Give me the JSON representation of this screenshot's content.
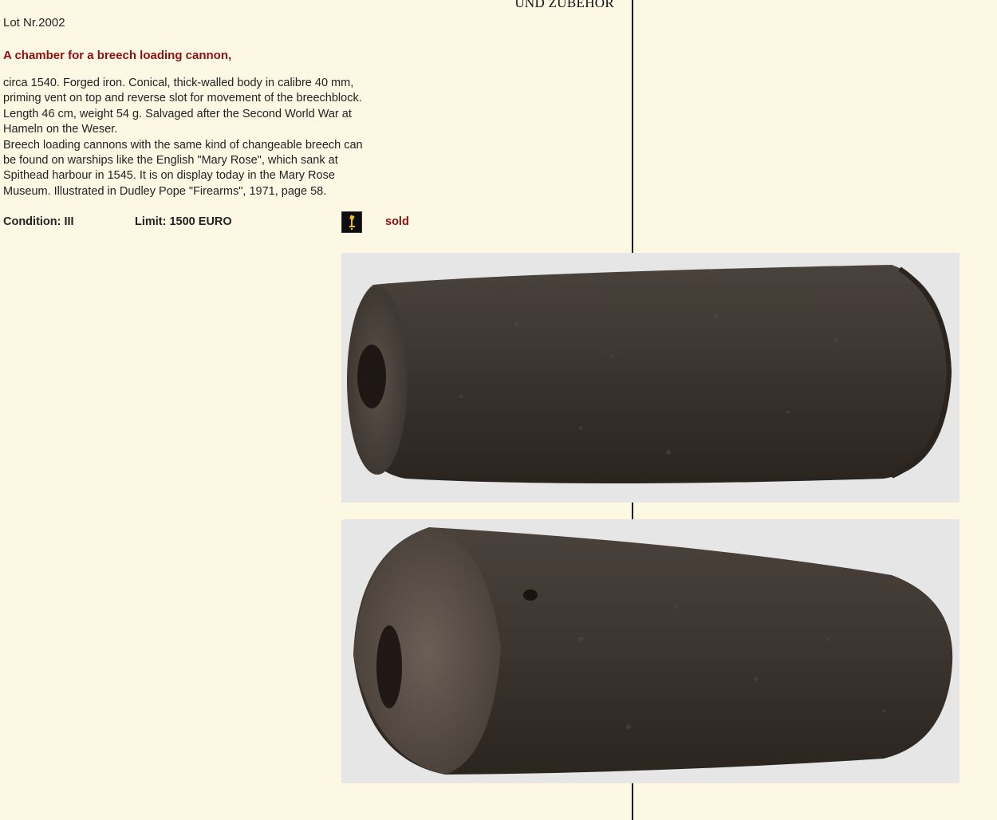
{
  "header": {
    "fragment": "UND ZUBEHÖR"
  },
  "lot": {
    "number": "Lot Nr.2002",
    "title": "A chamber for a breech loading cannon,",
    "description_lines": [
      "circa 1540. Forged iron. Conical, thick-walled body in calibre 40 mm,",
      "priming vent on top and reverse slot for movement of the breechblock.",
      "Length 46 cm, weight 54 g. Salvaged after the Second World War at",
      "Hameln on the Weser.",
      "Breech loading cannons with the same kind of changeable breech can",
      "be found on warships like the English \"Mary Rose\", which sank at",
      "Spithead harbour in 1545. It is on display today in the Mary Rose",
      "Museum. Illustrated in Dudley Pope \"Firearms\", 1971, page 58."
    ],
    "condition": "Condition: III",
    "limit": "Limit: 1500 EURO",
    "status_icon": "auction-hammer-icon",
    "status": "sold"
  },
  "photos": [
    {
      "name": "cannon-chamber-photo-side"
    },
    {
      "name": "cannon-chamber-photo-angled"
    }
  ],
  "colors": {
    "background": "#fdf8e4",
    "title_red": "#8b1010",
    "photo_bg": "#e6e6e6",
    "iron": "#3e3630"
  }
}
